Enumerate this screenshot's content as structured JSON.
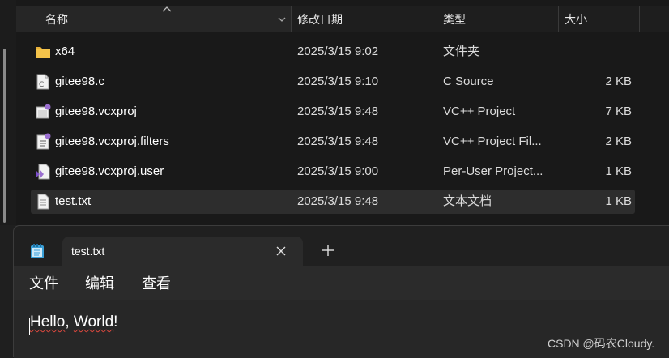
{
  "explorer": {
    "columns": {
      "name": "名称",
      "date": "修改日期",
      "type": "类型",
      "size": "大小"
    },
    "files": [
      {
        "name": "x64",
        "date": "2025/3/15 9:02",
        "type": "文件夹",
        "size": "",
        "icon": "folder-icon"
      },
      {
        "name": "gitee98.c",
        "date": "2025/3/15 9:10",
        "type": "C Source",
        "size": "2 KB",
        "icon": "c-source-file-icon"
      },
      {
        "name": "gitee98.vcxproj",
        "date": "2025/3/15 9:48",
        "type": "VC++ Project",
        "size": "7 KB",
        "icon": "vcxproj-file-icon"
      },
      {
        "name": "gitee98.vcxproj.filters",
        "date": "2025/3/15 9:48",
        "type": "VC++ Project Fil...",
        "size": "2 KB",
        "icon": "filters-file-icon"
      },
      {
        "name": "gitee98.vcxproj.user",
        "date": "2025/3/15 9:00",
        "type": "Per-User Project...",
        "size": "1 KB",
        "icon": "visual-studio-user-file-icon"
      },
      {
        "name": "test.txt",
        "date": "2025/3/15 9:48",
        "type": "文本文档",
        "size": "1 KB",
        "icon": "text-file-icon"
      }
    ]
  },
  "notepad": {
    "tab_title": "test.txt",
    "menu": {
      "file": "文件",
      "edit": "编辑",
      "view": "查看"
    },
    "content": {
      "word1": "Hello",
      "rest1": ", ",
      "word2": "World",
      "rest2": "!"
    }
  },
  "watermark": "CSDN @码农Cloudy.",
  "colors": {
    "folder": "#f4c34a",
    "notepad_icon": "#3aa0d8",
    "spell_error": "#e0483e"
  }
}
